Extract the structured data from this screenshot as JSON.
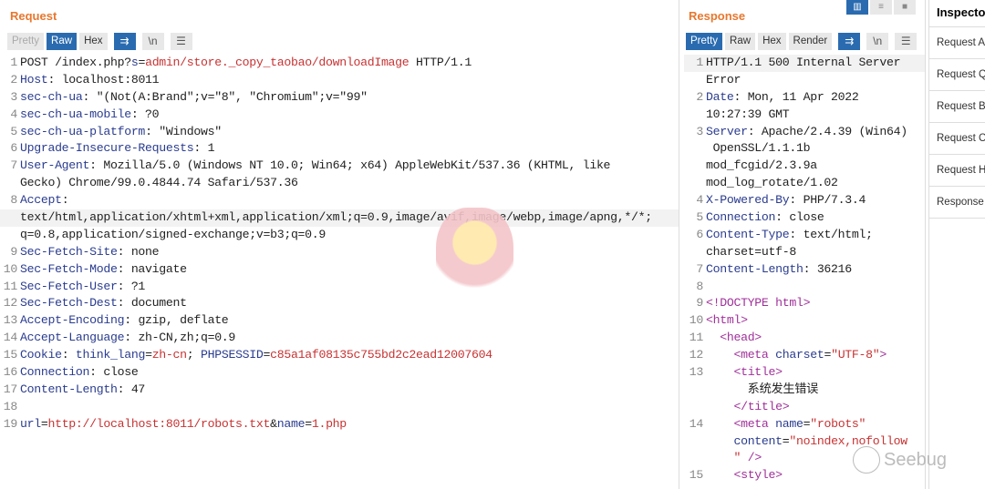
{
  "request": {
    "title": "Request",
    "tabs": [
      "Pretty",
      "Raw",
      "Hex"
    ],
    "active_tab": "Raw",
    "icons": [
      "wrap-icon",
      "newline-icon",
      "menu-icon"
    ],
    "newline_label": "\\n",
    "rows": [
      {
        "n": "1",
        "s": [
          [
            "d",
            "POST /index.php?"
          ],
          [
            "k",
            "s"
          ],
          [
            "d",
            "="
          ],
          [
            "r",
            "admin/store._copy_taobao/downloadImage"
          ],
          [
            "d",
            " HTTP/1.1"
          ]
        ]
      },
      {
        "n": "2",
        "s": [
          [
            "k",
            "Host"
          ],
          [
            "d",
            ": localhost:8011"
          ]
        ]
      },
      {
        "n": "3",
        "s": [
          [
            "k",
            "sec-ch-ua"
          ],
          [
            "d",
            ": \"(Not(A:Brand\";v=\"8\", \"Chromium\";v=\"99\""
          ]
        ]
      },
      {
        "n": "4",
        "s": [
          [
            "k",
            "sec-ch-ua-mobile"
          ],
          [
            "d",
            ": ?0"
          ]
        ]
      },
      {
        "n": "5",
        "s": [
          [
            "k",
            "sec-ch-ua-platform"
          ],
          [
            "d",
            ": \"Windows\""
          ]
        ]
      },
      {
        "n": "6",
        "s": [
          [
            "k",
            "Upgrade-Insecure-Requests"
          ],
          [
            "d",
            ": 1"
          ]
        ]
      },
      {
        "n": "7",
        "s": [
          [
            "k",
            "User-Agent"
          ],
          [
            "d",
            ": Mozilla/5.0 (Windows NT 10.0; Win64; x64) AppleWebKit/537.36 (KHTML, like"
          ]
        ]
      },
      {
        "n": "",
        "s": [
          [
            "d",
            "Gecko) Chrome/99.0.4844.74 Safari/537.36"
          ]
        ]
      },
      {
        "n": "8",
        "s": [
          [
            "k",
            "Accept"
          ],
          [
            "d",
            ":"
          ]
        ]
      },
      {
        "n": "",
        "hl": true,
        "s": [
          [
            "d",
            "text/html,application/xhtml+xml,application/xml;q=0.9,image/avif,image/webp,image/apng,*/*;"
          ]
        ]
      },
      {
        "n": "",
        "s": [
          [
            "d",
            "q=0.8,application/signed-exchange;v=b3;q=0.9"
          ]
        ]
      },
      {
        "n": "9",
        "s": [
          [
            "k",
            "Sec-Fetch-Site"
          ],
          [
            "d",
            ": none"
          ]
        ]
      },
      {
        "n": "10",
        "s": [
          [
            "k",
            "Sec-Fetch-Mode"
          ],
          [
            "d",
            ": navigate"
          ]
        ]
      },
      {
        "n": "11",
        "s": [
          [
            "k",
            "Sec-Fetch-User"
          ],
          [
            "d",
            ": ?1"
          ]
        ]
      },
      {
        "n": "12",
        "s": [
          [
            "k",
            "Sec-Fetch-Dest"
          ],
          [
            "d",
            ": document"
          ]
        ]
      },
      {
        "n": "13",
        "s": [
          [
            "k",
            "Accept-Encoding"
          ],
          [
            "d",
            ": gzip, deflate"
          ]
        ]
      },
      {
        "n": "14",
        "s": [
          [
            "k",
            "Accept-Language"
          ],
          [
            "d",
            ": zh-CN,zh;q=0.9"
          ]
        ]
      },
      {
        "n": "15",
        "s": [
          [
            "k",
            "Cookie"
          ],
          [
            "d",
            ": "
          ],
          [
            "k",
            "think_lang"
          ],
          [
            "d",
            "="
          ],
          [
            "r",
            "zh-cn"
          ],
          [
            "d",
            "; "
          ],
          [
            "k",
            "PHPSESSID"
          ],
          [
            "d",
            "="
          ],
          [
            "r",
            "c85a1af08135c755bd2c2ead12007604"
          ]
        ]
      },
      {
        "n": "16",
        "s": [
          [
            "k",
            "Connection"
          ],
          [
            "d",
            ": close"
          ]
        ]
      },
      {
        "n": "17",
        "s": [
          [
            "k",
            "Content-Length"
          ],
          [
            "d",
            ": 47"
          ]
        ]
      },
      {
        "n": "18",
        "s": []
      },
      {
        "n": "19",
        "s": [
          [
            "k",
            "url"
          ],
          [
            "d",
            "="
          ],
          [
            "r",
            "http://localhost:8011/robots.txt"
          ],
          [
            "d",
            "&"
          ],
          [
            "k",
            "name"
          ],
          [
            "d",
            "="
          ],
          [
            "r",
            "1.php"
          ]
        ]
      }
    ]
  },
  "response": {
    "title": "Response",
    "tabs": [
      "Pretty",
      "Raw",
      "Hex",
      "Render"
    ],
    "active_tab": "Pretty",
    "newline_label": "\\n",
    "rows": [
      {
        "n": "1",
        "hl": true,
        "s": [
          [
            "d",
            "HTTP/1.1 500 Internal Server"
          ]
        ]
      },
      {
        "n": "",
        "s": [
          [
            "d",
            "Error"
          ]
        ]
      },
      {
        "n": "2",
        "s": [
          [
            "k",
            "Date"
          ],
          [
            "d",
            ": Mon, 11 Apr 2022"
          ]
        ]
      },
      {
        "n": "",
        "s": [
          [
            "d",
            "10:27:39 GMT"
          ]
        ]
      },
      {
        "n": "3",
        "s": [
          [
            "k",
            "Server"
          ],
          [
            "d",
            ": Apache/2.4.39 (Win64)"
          ]
        ]
      },
      {
        "n": "",
        "s": [
          [
            "d",
            " OpenSSL/1.1.1b"
          ]
        ]
      },
      {
        "n": "",
        "s": [
          [
            "d",
            "mod_fcgid/2.3.9a"
          ]
        ]
      },
      {
        "n": "",
        "s": [
          [
            "d",
            "mod_log_rotate/1.02"
          ]
        ]
      },
      {
        "n": "4",
        "s": [
          [
            "k",
            "X-Powered-By"
          ],
          [
            "d",
            ": PHP/7.3.4"
          ]
        ]
      },
      {
        "n": "5",
        "s": [
          [
            "k",
            "Connection"
          ],
          [
            "d",
            ": close"
          ]
        ]
      },
      {
        "n": "6",
        "s": [
          [
            "k",
            "Content-Type"
          ],
          [
            "d",
            ": text/html;"
          ]
        ]
      },
      {
        "n": "",
        "s": [
          [
            "d",
            "charset=utf-8"
          ]
        ]
      },
      {
        "n": "7",
        "s": [
          [
            "k",
            "Content-Length"
          ],
          [
            "d",
            ": 36216"
          ]
        ]
      },
      {
        "n": "8",
        "s": []
      },
      {
        "n": "9",
        "s": [
          [
            "p",
            "<!DOCTYPE html>"
          ]
        ]
      },
      {
        "n": "10",
        "s": [
          [
            "p",
            "<html>"
          ]
        ]
      },
      {
        "n": "11",
        "s": [
          [
            "d",
            "  "
          ],
          [
            "p",
            "<head>"
          ]
        ]
      },
      {
        "n": "12",
        "s": [
          [
            "d",
            "    "
          ],
          [
            "p",
            "<meta "
          ],
          [
            "k",
            "charset"
          ],
          [
            "d",
            "="
          ],
          [
            "r",
            "\"UTF-8\""
          ],
          [
            "p",
            ">"
          ]
        ]
      },
      {
        "n": "13",
        "s": [
          [
            "d",
            "    "
          ],
          [
            "p",
            "<title>"
          ]
        ]
      },
      {
        "n": "",
        "s": [
          [
            "d",
            "      系统发生错误"
          ]
        ]
      },
      {
        "n": "",
        "s": [
          [
            "d",
            "    "
          ],
          [
            "p",
            "</title>"
          ]
        ]
      },
      {
        "n": "14",
        "s": [
          [
            "d",
            "    "
          ],
          [
            "p",
            "<meta "
          ],
          [
            "k",
            "name"
          ],
          [
            "d",
            "="
          ],
          [
            "r",
            "\"robots\""
          ]
        ]
      },
      {
        "n": "",
        "s": [
          [
            "d",
            "    "
          ],
          [
            "k",
            "content"
          ],
          [
            "d",
            "="
          ],
          [
            "r",
            "\"noindex,nofollow"
          ]
        ]
      },
      {
        "n": "",
        "s": [
          [
            "d",
            "    "
          ],
          [
            "r",
            "\""
          ],
          [
            "p",
            " />"
          ]
        ]
      },
      {
        "n": "15",
        "s": [
          [
            "d",
            "    "
          ],
          [
            "p",
            "<style>"
          ]
        ]
      }
    ]
  },
  "inspector": {
    "title": "Inspector",
    "items": [
      "Request Attributes",
      "Request Query Parameters",
      "Request Body Parameters",
      "Request Cookies",
      "Request Headers",
      "Response Headers"
    ]
  },
  "layout_buttons": [
    "split-horizontal-icon",
    "split-vertical-icon",
    "single-pane-icon"
  ],
  "watermark": "Seebug",
  "colors": {
    "accent": "#2a6bb0",
    "title": "#e8772e",
    "key": "#2a3c8f",
    "value": "#c83232"
  }
}
